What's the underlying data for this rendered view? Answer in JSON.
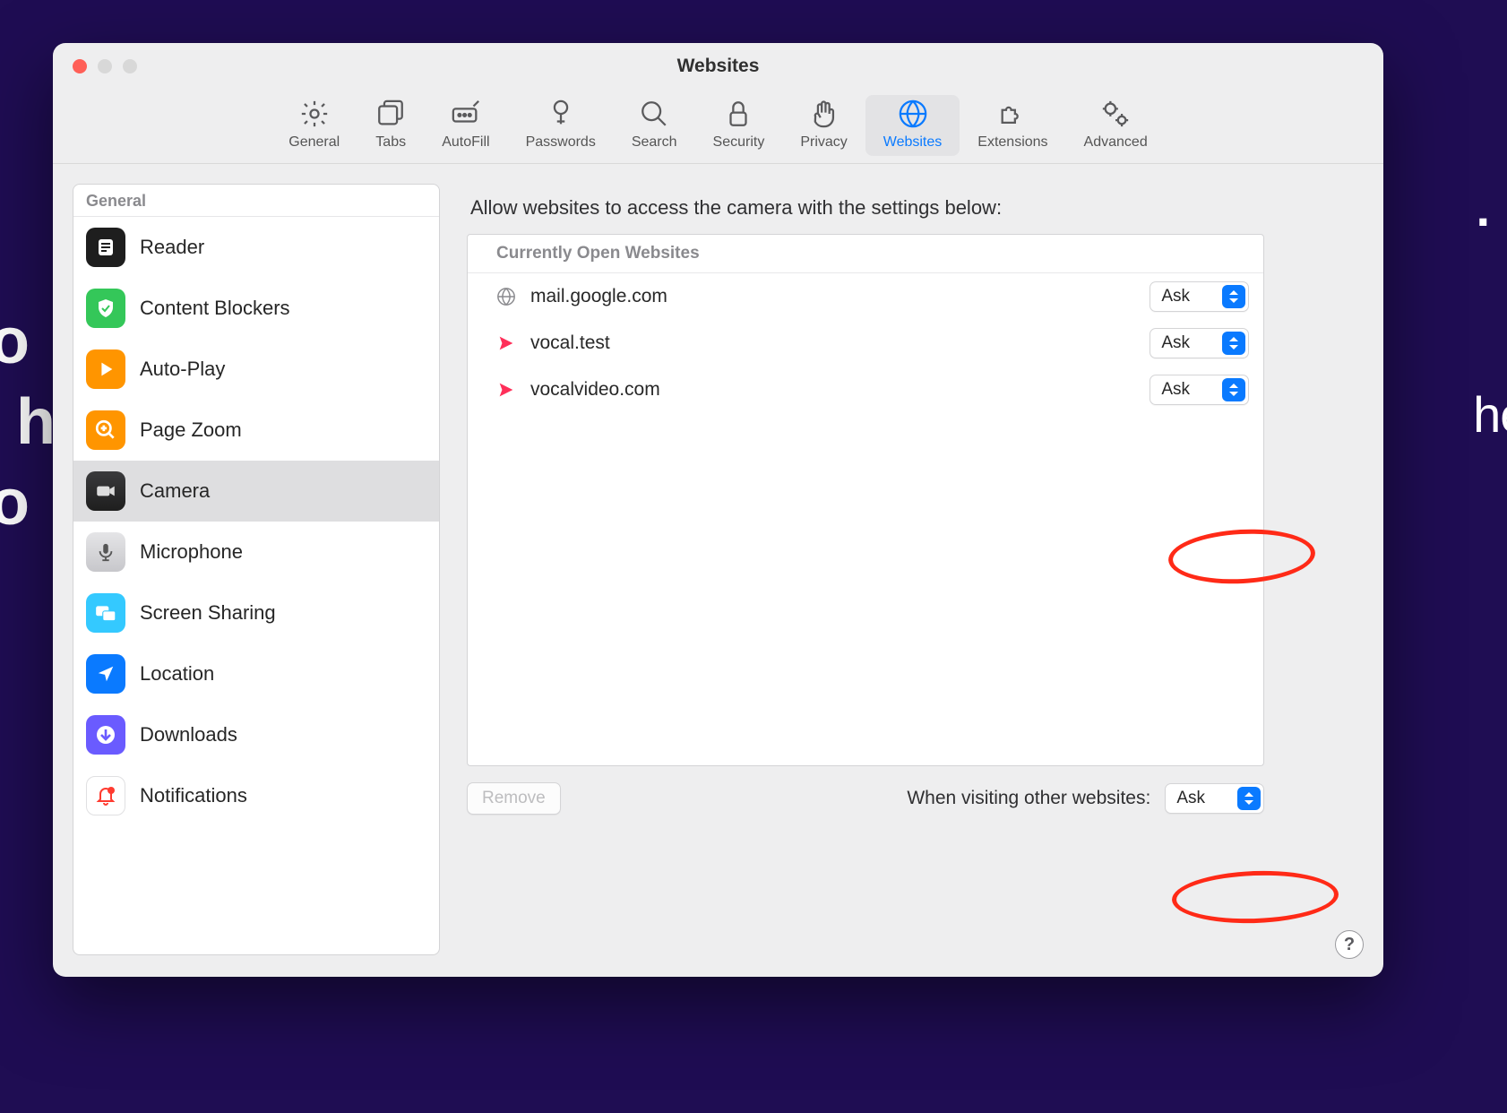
{
  "window": {
    "title": "Websites"
  },
  "toolbar": [
    {
      "id": "general",
      "label": "General"
    },
    {
      "id": "tabs",
      "label": "Tabs"
    },
    {
      "id": "autofill",
      "label": "AutoFill"
    },
    {
      "id": "passwords",
      "label": "Passwords"
    },
    {
      "id": "search",
      "label": "Search"
    },
    {
      "id": "security",
      "label": "Security"
    },
    {
      "id": "privacy",
      "label": "Privacy"
    },
    {
      "id": "websites",
      "label": "Websites",
      "selected": true
    },
    {
      "id": "extensions",
      "label": "Extensions"
    },
    {
      "id": "advanced",
      "label": "Advanced"
    }
  ],
  "sidebar": {
    "group_label": "General",
    "items": [
      {
        "id": "reader",
        "label": "Reader"
      },
      {
        "id": "blockers",
        "label": "Content Blockers"
      },
      {
        "id": "autoplay",
        "label": "Auto-Play"
      },
      {
        "id": "pagezoom",
        "label": "Page Zoom"
      },
      {
        "id": "camera",
        "label": "Camera",
        "selected": true
      },
      {
        "id": "microphone",
        "label": "Microphone"
      },
      {
        "id": "screenshare",
        "label": "Screen Sharing"
      },
      {
        "id": "location",
        "label": "Location"
      },
      {
        "id": "downloads",
        "label": "Downloads"
      },
      {
        "id": "notifications",
        "label": "Notifications"
      }
    ]
  },
  "main": {
    "description": "Allow websites to access the camera with the settings below:",
    "table_heading": "Currently Open Websites",
    "rows": [
      {
        "site": "mail.google.com",
        "icon": "globe",
        "value": "Ask"
      },
      {
        "site": "vocal.test",
        "icon": "vocal",
        "value": "Ask"
      },
      {
        "site": "vocalvideo.com",
        "icon": "vocal",
        "value": "Ask",
        "annotated": true
      }
    ],
    "remove_label": "Remove",
    "other_label": "When visiting other websites:",
    "other_value": "Ask"
  },
  "help_label": "?"
}
